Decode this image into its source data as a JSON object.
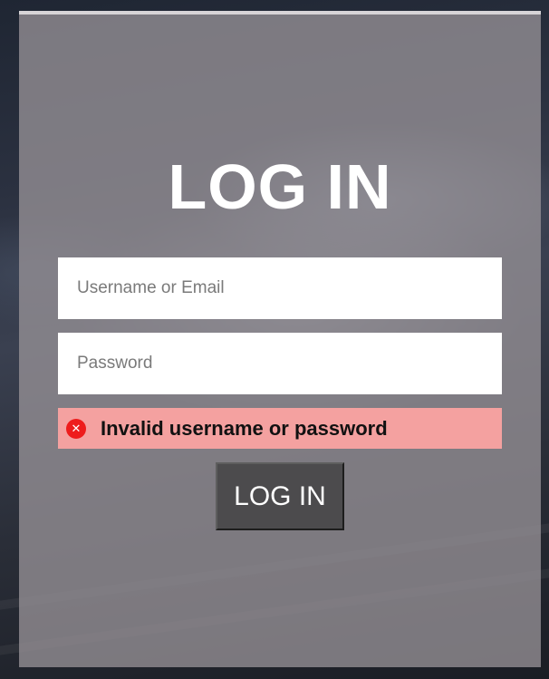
{
  "login": {
    "title": "LOG IN",
    "username_placeholder": "Username or Email",
    "username_value": "",
    "password_placeholder": "Password",
    "password_value": "",
    "error_message": "Invalid username or password",
    "submit_label": "LOG IN"
  },
  "icons": {
    "error": "error-circle-x-icon"
  },
  "colors": {
    "panel": "#969196",
    "error_background": "#f4a1a0",
    "error_icon": "#ee1c1c",
    "button": "#4c4b4d",
    "title": "#ffffff"
  }
}
